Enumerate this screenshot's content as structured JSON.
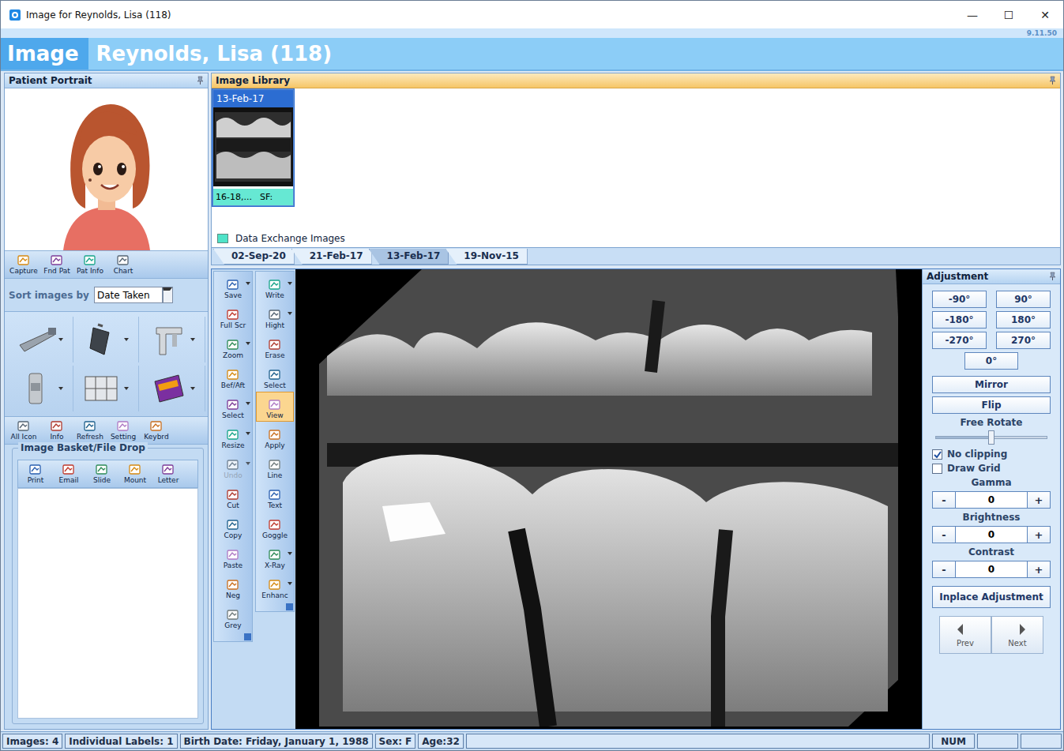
{
  "window": {
    "title": "Image for Reynolds, Lisa (118)",
    "controls": [
      "—",
      "☐",
      "✕"
    ],
    "version": "9.11.50"
  },
  "header": {
    "module": "Image",
    "patient": "Reynolds, Lisa (118)"
  },
  "portrait_panel": {
    "title": "Patient Portrait",
    "toolbar": [
      "Capture",
      "Fnd Pat",
      "Pat Info",
      "Chart"
    ],
    "sort_label": "Sort images by",
    "sort_value": "Date Taken"
  },
  "device_toolbar": [
    "All Icon",
    "Info",
    "Refresh",
    "Setting",
    "Keybrd"
  ],
  "basket": {
    "title": "Image Basket/File Drop",
    "buttons": [
      "Print",
      "Email",
      "Slide",
      "Mount",
      "Letter"
    ]
  },
  "library": {
    "title": "Image Library",
    "thumbnails": [
      {
        "date": "13-Feb-17",
        "caption": "16-18,...",
        "flag": "SF:",
        "color": "#66e8d3",
        "selected": true
      }
    ],
    "legend": [
      {
        "label": "Data Exchange Images",
        "color": "#4fe3c8"
      }
    ],
    "tabs": [
      {
        "label": "02-Sep-20",
        "selected": false
      },
      {
        "label": "21-Feb-17",
        "selected": false
      },
      {
        "label": "13-Feb-17",
        "selected": true
      },
      {
        "label": "19-Nov-15",
        "selected": false
      }
    ]
  },
  "tools": {
    "left": [
      {
        "label": "Save",
        "dropdown": true,
        "disabled": false,
        "selected": false
      },
      {
        "label": "Full Scr",
        "dropdown": false,
        "disabled": false,
        "selected": false
      },
      {
        "label": "Zoom",
        "dropdown": true,
        "disabled": false,
        "selected": false
      },
      {
        "label": "Bef/Aft",
        "dropdown": false,
        "disabled": false,
        "selected": false
      },
      {
        "label": "Select",
        "dropdown": true,
        "disabled": false,
        "selected": false
      },
      {
        "label": "Resize",
        "dropdown": true,
        "disabled": false,
        "selected": false
      },
      {
        "label": "Undo",
        "dropdown": true,
        "disabled": true,
        "selected": false
      },
      {
        "label": "Cut",
        "dropdown": false,
        "disabled": false,
        "selected": false
      },
      {
        "label": "Copy",
        "dropdown": false,
        "disabled": false,
        "selected": false
      },
      {
        "label": "Paste",
        "dropdown": false,
        "disabled": false,
        "selected": false
      },
      {
        "label": "Neg",
        "dropdown": false,
        "disabled": false,
        "selected": false
      },
      {
        "label": "Grey",
        "dropdown": false,
        "disabled": false,
        "selected": false
      }
    ],
    "right": [
      {
        "label": "Write",
        "dropdown": true,
        "disabled": false,
        "selected": false
      },
      {
        "label": "Hight",
        "dropdown": true,
        "disabled": false,
        "selected": false
      },
      {
        "label": "Erase",
        "dropdown": false,
        "disabled": false,
        "selected": false
      },
      {
        "label": "Select",
        "dropdown": false,
        "disabled": false,
        "selected": false
      },
      {
        "label": "View",
        "dropdown": false,
        "disabled": false,
        "selected": true
      },
      {
        "label": "Apply",
        "dropdown": false,
        "disabled": false,
        "selected": false
      },
      {
        "label": "Line",
        "dropdown": false,
        "disabled": false,
        "selected": false
      },
      {
        "label": "Text",
        "dropdown": false,
        "disabled": false,
        "selected": false
      },
      {
        "label": "Goggle",
        "dropdown": false,
        "disabled": false,
        "selected": false
      },
      {
        "label": "X-Ray",
        "dropdown": true,
        "disabled": false,
        "selected": false
      },
      {
        "label": "Enhanc",
        "dropdown": true,
        "disabled": false,
        "selected": false
      }
    ]
  },
  "adjustment": {
    "title": "Adjustment",
    "rotations": [
      "-90°",
      "90°",
      "-180°",
      "180°",
      "-270°",
      "270°"
    ],
    "reset": "0°",
    "mirror": "Mirror",
    "flip": "Flip",
    "free_rotate": {
      "label": "Free Rotate",
      "level": 0.5
    },
    "checkboxes": [
      {
        "label": "No clipping",
        "checked": true
      },
      {
        "label": "Draw Grid",
        "checked": false
      }
    ],
    "steppers": [
      {
        "label": "Gamma",
        "minus": "-",
        "value": "0",
        "plus": "+"
      },
      {
        "label": "Brightness",
        "minus": "-",
        "value": "0",
        "plus": "+"
      },
      {
        "label": "Contrast",
        "minus": "-",
        "value": "0",
        "plus": "+"
      }
    ],
    "inplace": "Inplace Adjustment",
    "nav": [
      "Prev",
      "Next"
    ]
  },
  "status_bar": {
    "left": [
      "Images: 4",
      "Individual Labels: 1",
      "Birth Date: Friday, January 1, 1988",
      "Sex: F",
      "Age:32"
    ],
    "right": [
      "NUM"
    ]
  }
}
